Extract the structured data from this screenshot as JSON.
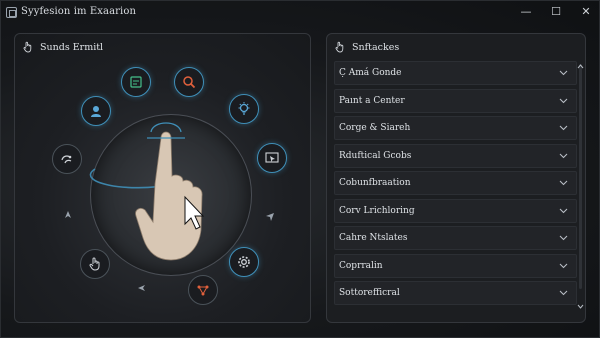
{
  "window": {
    "title": "Syyfesion im Exaarion",
    "controls": {
      "minimize": "—",
      "maximize": "☐",
      "close": "✕"
    }
  },
  "left_panel": {
    "title": "Sunds Ermitl",
    "nodes": [
      {
        "icon": "gesture-doc-icon"
      },
      {
        "icon": "search-icon"
      },
      {
        "icon": "user-icon"
      },
      {
        "icon": "lightbulb-icon"
      },
      {
        "icon": "gesture-tap-icon"
      },
      {
        "icon": "window-cursor-icon"
      },
      {
        "icon": "hand-icon"
      },
      {
        "icon": "settings-gear-icon"
      },
      {
        "icon": "network-icon"
      }
    ]
  },
  "right_panel": {
    "title": "Snftackes",
    "items": [
      {
        "label": "C̣ Amá Gonde"
      },
      {
        "label": "Paınt a Center"
      },
      {
        "label": "Corge & Siareh"
      },
      {
        "label": "Rduftical Gcobs"
      },
      {
        "label": "Cobunfbraation"
      },
      {
        "label": "Corv Lrichloring"
      },
      {
        "label": "Cahre Ntslates"
      },
      {
        "label": "Coprralin"
      },
      {
        "label": "Sottorefficral"
      }
    ]
  },
  "colors": {
    "accent": "#3f8fb8",
    "background": "#0e1013",
    "panel": "#1c1e21"
  }
}
